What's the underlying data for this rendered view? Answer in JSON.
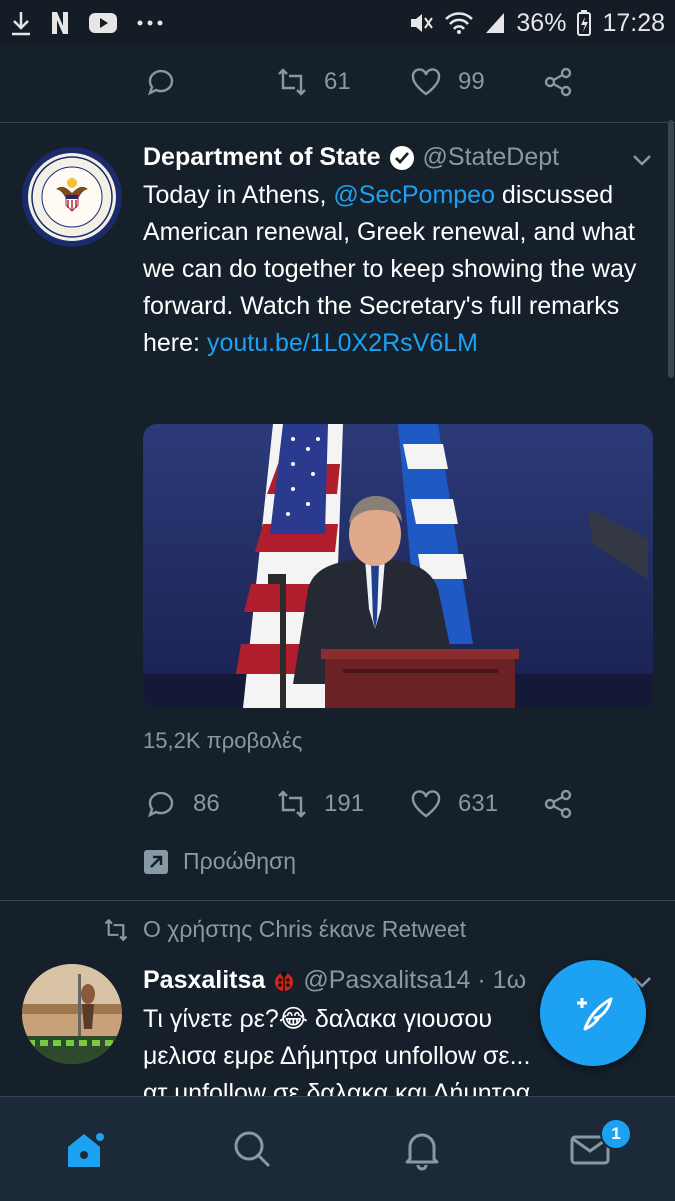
{
  "status_bar": {
    "left_icons": [
      "download-icon",
      "netflix-icon",
      "youtube-icon",
      "more-dots-icon"
    ],
    "battery": "36%",
    "time": "17:28"
  },
  "prev_tweet_actions": {
    "retweets": "61",
    "likes": "99"
  },
  "tweet1": {
    "name": "Department of State",
    "handle": "@StateDept",
    "text_mention": "@SecPompeo",
    "text_before": "Today in Athens, ",
    "text_after": " discussed American renewal, Greek renewal, and what we can do together to keep showing the way forward. Watch the Secretary's full remarks here: ",
    "link": "youtu.be/1L0X2RsV6LM",
    "views": "15,2K προβολές",
    "replies": "86",
    "retweets": "191",
    "likes": "631",
    "promote_label": "Προώθηση"
  },
  "retweet_note": "Ο χρήστης Chris έκανε Retweet",
  "tweet2": {
    "name": "Pasxalitsa",
    "handle": "@Pasxalitsa14 · 1ω",
    "line1": "Τι γίνετε ρε?😂 δαλακα γιουσου",
    "line2": "μελισα εμρε Δήμητρα unfollow σε...",
    "line3": "ατ unfollow σε δαλακα και Δήμητρα"
  },
  "bottom_nav": {
    "items": [
      "home-icon",
      "search-icon",
      "notifications-icon",
      "messages-icon"
    ],
    "messages_badge": "1"
  },
  "colors": {
    "background": "#15202b",
    "accent": "#1da1f2",
    "muted": "#8899a6"
  }
}
